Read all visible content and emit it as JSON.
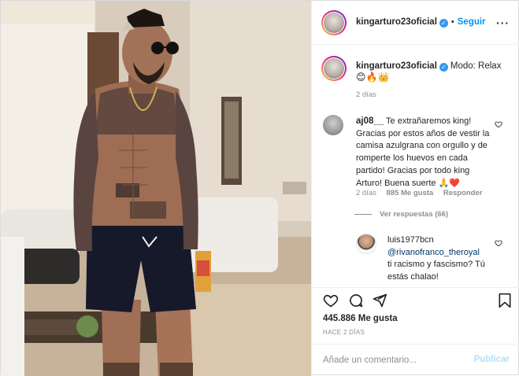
{
  "header": {
    "username": "kingarturo23oficial",
    "verified_mark": "✓",
    "separator": "•",
    "follow_label": "Seguir",
    "more_label": "···"
  },
  "caption": {
    "username": "kingarturo23oficial",
    "text": "Modo: Relax",
    "emojis": "😊🔥👑",
    "time": "2 días"
  },
  "comments": [
    {
      "username": "aj08__",
      "text": "Te extrañaremos king! Gracias por estos años de vestir la camisa azulgrana con orgullo y de romperte los huevos en cada partido! Gracias por todo king Arturo! Buena suerte 🙏❤️",
      "time": "2 días",
      "likes": "885 Me gusta",
      "reply_label": "Responder",
      "view_replies": "Ver respuestas (66)"
    },
    {
      "username": "luis1977bcn",
      "mention": "@rivanofranco_theroyal",
      "text": "ti racismo y fascismo? Tú estás chalao!"
    }
  ],
  "actions": {
    "like_icon": "heart-icon",
    "comment_icon": "comment-icon",
    "share_icon": "share-icon",
    "save_icon": "bookmark-icon"
  },
  "likes_text": "445.886 Me gusta",
  "posted_ago": "HACE 2 DÍAS",
  "comment_input": {
    "placeholder": "Añade un comentario...",
    "publish_label": "Publicar"
  },
  "colors": {
    "link_blue": "#0095f6",
    "verified_blue": "#3897f0",
    "muted": "#8e8e8e",
    "publish_disabled": "#b2dffc"
  }
}
